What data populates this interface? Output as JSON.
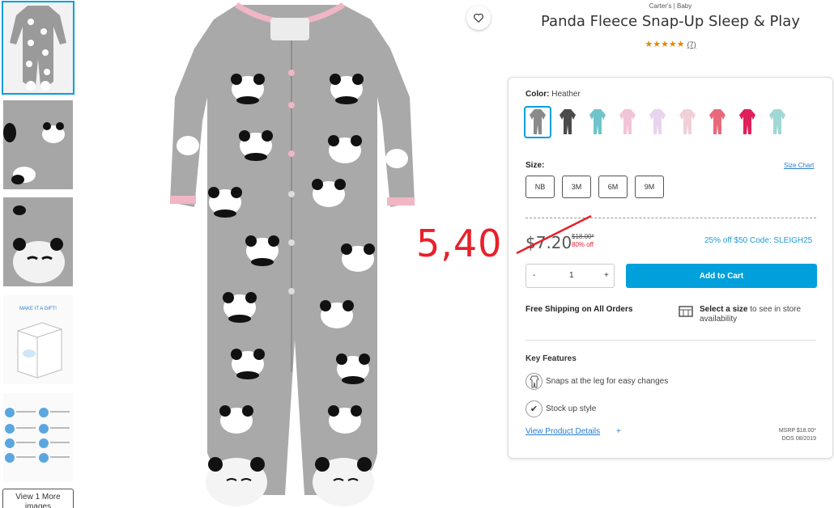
{
  "product": {
    "brand": "Carter's | Baby",
    "title": "Panda Fleece Snap-Up Sleep & Play",
    "stars": "★★★★★",
    "review_count": "(7)"
  },
  "thumbnails": {
    "gift_text": "MAKE IT A GIFT!",
    "view_more": "View 1 More images"
  },
  "annotation": {
    "text": "5,40",
    "color": "#e8202a"
  },
  "options": {
    "color_label": "Color:",
    "color_value": "Heather",
    "swatches": [
      "#8a8a8a",
      "#4a4a4a",
      "#6fc4c9",
      "#f2c4d8",
      "#e8d4ee",
      "#f0d0d8",
      "#e86a7a",
      "#e0205a",
      "#9fd8d4"
    ],
    "size_label": "Size:",
    "size_chart": "Size Chart",
    "sizes": [
      "NB",
      "3M",
      "6M",
      "9M"
    ]
  },
  "pricing": {
    "price": "$7.20",
    "old_price": "$18.00*",
    "discount": "80% off",
    "promo": "25% off $50 Code: SLEIGH25"
  },
  "cart": {
    "minus": "-",
    "qty": "1",
    "plus": "+",
    "add_label": "Add to Cart"
  },
  "shipping": {
    "free": "Free Shipping on All Orders",
    "store_bold": "Select a size",
    "store_rest": " to see in store availability"
  },
  "features": {
    "heading": "Key Features",
    "items": [
      "Snaps at the leg for easy changes",
      "Stock up style"
    ],
    "details_link": "View Product Details",
    "details_plus": "+",
    "msrp": "MSRP $18.00*",
    "dos": "DOS 08/2019"
  },
  "colors": {
    "accent": "#00a0dc",
    "link": "#2a7bd1",
    "sale": "#e8202a",
    "promo": "#1e9ad6",
    "star": "#e08a00"
  }
}
